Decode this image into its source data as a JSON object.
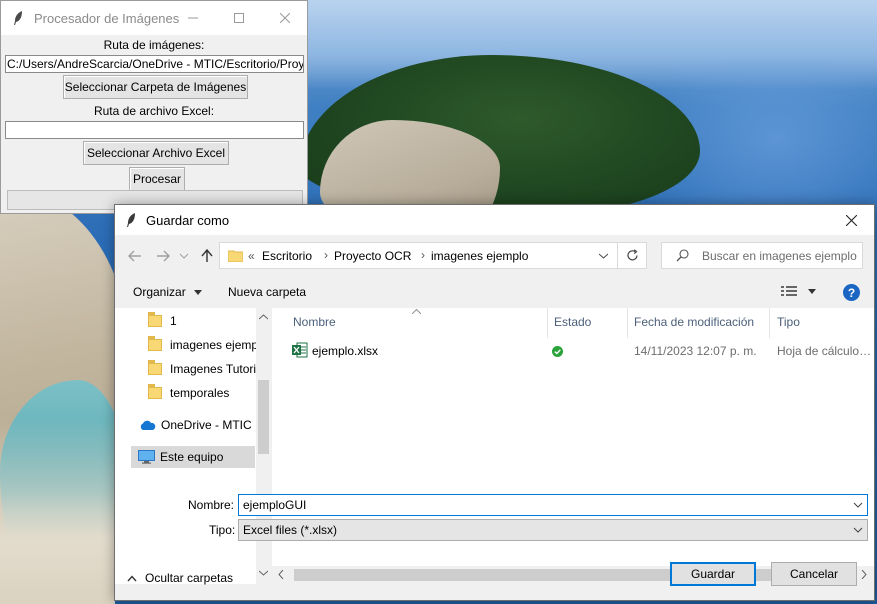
{
  "tk_window": {
    "title": "Procesador de Imágenes",
    "images_path_label": "Ruta de imágenes:",
    "images_path_value": "C:/Users/AndreScarcia/OneDrive - MTIC/Escritorio/Proyecto OCR/imagenes ejemplo",
    "select_folder_button": "Seleccionar Carpeta de Imágenes",
    "excel_path_label": "Ruta de archivo Excel:",
    "excel_path_value": "",
    "select_excel_button": "Seleccionar Archivo Excel",
    "process_button": "Procesar",
    "progress": 0
  },
  "save_dialog": {
    "title": "Guardar como",
    "breadcrumb": {
      "overflow": "«",
      "items": [
        "Escritorio",
        "Proyecto OCR",
        "imagenes ejemplo"
      ]
    },
    "search_placeholder": "Buscar en imagenes ejemplo",
    "toolbar": {
      "organize": "Organizar",
      "new_folder": "Nueva carpeta"
    },
    "nav_items": [
      {
        "label": "1",
        "icon": "folder-icon"
      },
      {
        "label": "imagenes ejemplo",
        "icon": "folder-icon"
      },
      {
        "label": "Imagenes Tutorial",
        "icon": "folder-icon"
      },
      {
        "label": "temporales",
        "icon": "folder-icon"
      },
      {
        "label": "OneDrive - MTIC",
        "icon": "cloud-icon"
      },
      {
        "label": "Este equipo",
        "icon": "computer-icon",
        "selected": true
      }
    ],
    "columns": [
      "Nombre",
      "Estado",
      "Fecha de modificación",
      "Tipo"
    ],
    "files": [
      {
        "name": "ejemplo.xlsx",
        "icon": "excel-file-icon",
        "status": "synced",
        "modified": "14/11/2023 12:07 p. m.",
        "type": "Hoja de cálculo de Microsoft Excel"
      }
    ],
    "name_label": "Nombre:",
    "name_value": "ejemploGUI",
    "type_label": "Tipo:",
    "type_value": "Excel files (*.xlsx)",
    "hide_folders": "Ocultar carpetas",
    "save_button": "Guardar",
    "cancel_button": "Cancelar",
    "accent_color": "#0078d7"
  }
}
